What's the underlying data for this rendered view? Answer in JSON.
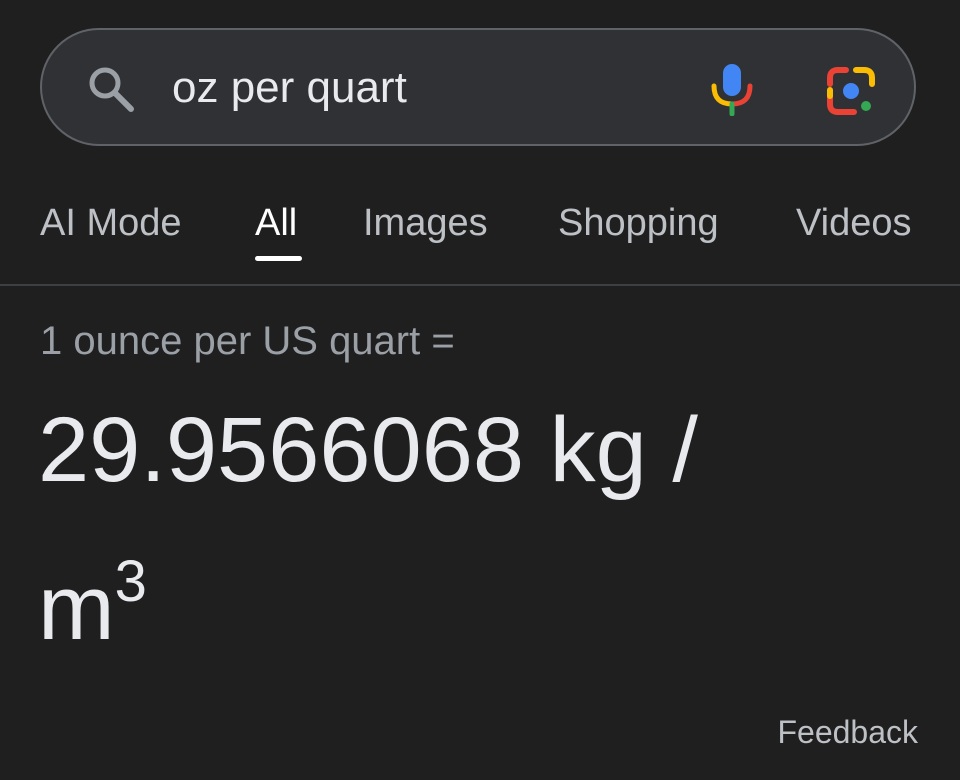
{
  "search": {
    "query": "oz per quart",
    "icons": {
      "search": "search-icon",
      "voice": "microphone-icon",
      "lens": "google-lens-icon"
    }
  },
  "tabs": [
    {
      "label": "AI Mode",
      "active": false
    },
    {
      "label": "All",
      "active": true
    },
    {
      "label": "Images",
      "active": false
    },
    {
      "label": "Shopping",
      "active": false
    },
    {
      "label": "Videos",
      "active": false
    }
  ],
  "converter": {
    "input_label": "1 ounce per US quart =",
    "result_number": "29.9566068 kg /",
    "result_unit_base": "m",
    "result_unit_exponent": "3"
  },
  "feedback_label": "Feedback",
  "colors": {
    "background": "#1f1f1f",
    "search_bg": "#303134",
    "text_primary": "#e8eaed",
    "text_secondary": "#9aa0a6",
    "google_blue": "#4285f4",
    "google_red": "#ea4335",
    "google_yellow": "#fbbc04",
    "google_green": "#34a853"
  }
}
